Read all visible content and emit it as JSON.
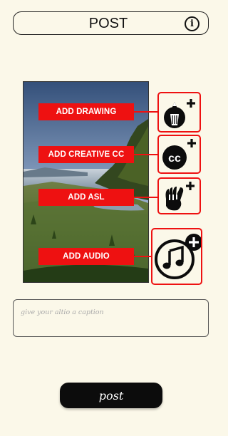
{
  "header": {
    "title": "POST",
    "info_icon": "info-icon",
    "info_glyph": "i"
  },
  "photo": {
    "description_icon": "landscape-photo"
  },
  "tools": [
    {
      "label": "ADD DRAWING",
      "icon": "pencil-plus-icon",
      "accent": "#ee1111"
    },
    {
      "label": "ADD CREATIVE CC",
      "icon": "closed-caption-plus-icon",
      "accent": "#ee1111"
    },
    {
      "label": "ADD ASL",
      "icon": "sign-language-hand-plus-icon",
      "accent": "#ee1111"
    },
    {
      "label": "ADD AUDIO",
      "icon": "music-note-plus-icon",
      "accent": "#ee1111"
    }
  ],
  "caption": {
    "placeholder": "give your altio a caption"
  },
  "post_button": {
    "label": "post"
  }
}
